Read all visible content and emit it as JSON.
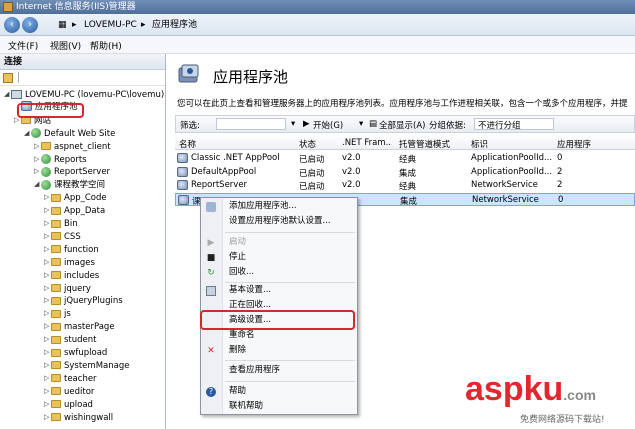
{
  "window": {
    "title": "Internet 信息服务(IIS)管理器"
  },
  "address": {
    "crumbs": [
      "LOVEMU-PC",
      "应用程序池"
    ],
    "sep": "▸"
  },
  "menu": {
    "items": [
      "文件(F)",
      "视图(V)",
      "帮助(H)"
    ]
  },
  "connections": {
    "header": "连接",
    "tree": [
      {
        "label": "LOVEMU-PC (lovemu-PC\\lovemu)",
        "icon": "pc"
      },
      {
        "label": "应用程序池",
        "icon": "pool"
      },
      {
        "label": "网站",
        "icon": "folder"
      },
      {
        "label": "Default Web Site",
        "icon": "globe"
      },
      {
        "label": "aspnet_client",
        "icon": "folder"
      },
      {
        "label": "Reports",
        "icon": "globe"
      },
      {
        "label": "ReportServer",
        "icon": "globe"
      },
      {
        "label": "课程教学空间",
        "icon": "globe"
      },
      {
        "label": "App_Code",
        "icon": "folder"
      },
      {
        "label": "App_Data",
        "icon": "folder"
      },
      {
        "label": "Bin",
        "icon": "folder"
      },
      {
        "label": "CSS",
        "icon": "folder"
      },
      {
        "label": "function",
        "icon": "folder"
      },
      {
        "label": "images",
        "icon": "folder"
      },
      {
        "label": "includes",
        "icon": "folder"
      },
      {
        "label": "jquery",
        "icon": "folder"
      },
      {
        "label": "jQueryPlugins",
        "icon": "folder"
      },
      {
        "label": "js",
        "icon": "folder"
      },
      {
        "label": "masterPage",
        "icon": "folder"
      },
      {
        "label": "student",
        "icon": "folder"
      },
      {
        "label": "swfupload",
        "icon": "folder"
      },
      {
        "label": "SystemManage",
        "icon": "folder"
      },
      {
        "label": "teacher",
        "icon": "folder"
      },
      {
        "label": "ueditor",
        "icon": "folder"
      },
      {
        "label": "upload",
        "icon": "folder"
      },
      {
        "label": "wishingwall",
        "icon": "folder"
      }
    ]
  },
  "main": {
    "title": "应用程序池",
    "description": "您可以在此页上查看和管理服务器上的应用程序池列表。应用程序池与工作进程相关联，包含一个或多个应用程序，并提",
    "filter": {
      "label": "筛选:",
      "start": "开始(G)",
      "show_all": "全部显示(A)",
      "group_label": "分组依据:",
      "group_value": "不进行分组"
    },
    "columns": [
      "名称",
      "状态",
      ".NET Fram...",
      "托管管道模式",
      "标识",
      "应用程序"
    ],
    "rows": [
      [
        "Classic .NET AppPool",
        "已启动",
        "v2.0",
        "经典",
        "ApplicationPoolId...",
        "0"
      ],
      [
        "DefaultAppPool",
        "已启动",
        "v2.0",
        "集成",
        "ApplicationPoolId...",
        "2"
      ],
      [
        "ReportServer",
        "已启动",
        "v2.0",
        "经典",
        "NetworkService",
        "2"
      ],
      [
        "课",
        "",
        "",
        "集成",
        "NetworkService",
        "0"
      ]
    ]
  },
  "context_menu": {
    "items": [
      {
        "label": "添加应用程序池...",
        "icon": "pool-icon",
        "disabled": false
      },
      {
        "label": "设置应用程序池默认设置...",
        "icon": "",
        "disabled": false
      },
      {
        "label": "启动",
        "icon": "play-icon",
        "disabled": true
      },
      {
        "label": "停止",
        "icon": "stop-icon",
        "disabled": false
      },
      {
        "label": "回收...",
        "icon": "recycle-icon",
        "disabled": false
      },
      {
        "label": "基本设置...",
        "icon": "settings-icon",
        "disabled": false
      },
      {
        "label": "正在回收...",
        "icon": "",
        "disabled": false
      },
      {
        "label": "高级设置...",
        "icon": "",
        "disabled": false
      },
      {
        "label": "重命名",
        "icon": "",
        "disabled": false
      },
      {
        "label": "删除",
        "icon": "delete-icon",
        "disabled": false
      },
      {
        "label": "查看应用程序",
        "icon": "",
        "disabled": false
      },
      {
        "label": "帮助",
        "icon": "help-icon",
        "disabled": false
      },
      {
        "label": "联机帮助",
        "icon": "",
        "disabled": false
      }
    ]
  },
  "watermark": {
    "brand_a": "asp",
    "brand_b": "ku",
    "brand_c": ".com",
    "sub": "免费网络源码下载站!"
  },
  "colors": {
    "highlight": "#d3282f",
    "accent": "#4f6f99"
  }
}
